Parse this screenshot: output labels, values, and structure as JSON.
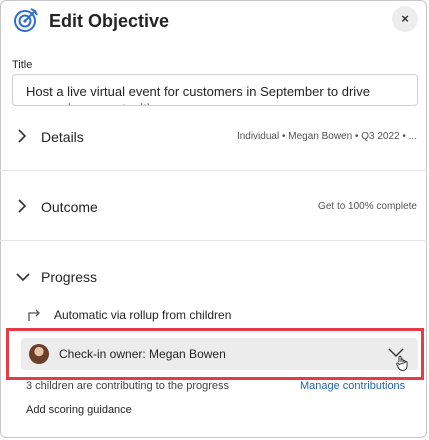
{
  "header": {
    "title": "Edit Objective",
    "close_icon_label": "×"
  },
  "title_field": {
    "label": "Title",
    "value": "Host a live virtual event for customers in September to drive expansion opportunities"
  },
  "sections": {
    "details": {
      "label": "Details",
      "summary": "Individual • Megan Bowen • Q3 2022 • ..."
    },
    "outcome": {
      "label": "Outcome",
      "summary": "Get to 100% complete"
    },
    "progress": {
      "label": "Progress",
      "rollup_text": "Automatic via rollup from children",
      "checkin_owner": "Check-in owner: Megan Bowen",
      "children_text": "3 children are contributing to the progress",
      "manage_link": "Manage contributions",
      "scoring_guidance": "Add scoring guidance"
    }
  },
  "colors": {
    "accent": "#2563b0",
    "highlight": "#e43b47"
  }
}
